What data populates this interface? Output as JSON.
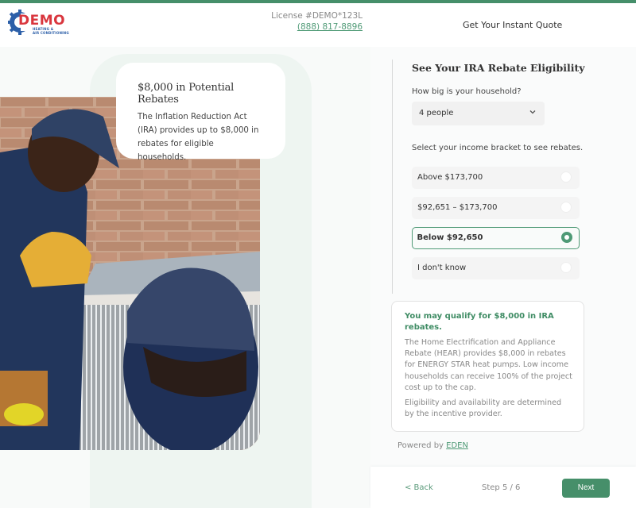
{
  "header": {
    "logo": {
      "brand": "DEMO",
      "subtitle_line1": "HEATING &",
      "subtitle_line2": "AIR CONDITIONING"
    },
    "license": "License #DEMO*123L",
    "phone": "(888) 817-8896",
    "quote_link": "Get Your Instant Quote"
  },
  "colors": {
    "accent": "#468f6a",
    "brand_red": "#d9363e",
    "brand_blue": "#2c5fa8"
  },
  "callout": {
    "title": "$8,000 in Potential Rebates",
    "body": "The Inflation Reduction Act (IRA) provides up to $8,000 in rebates for eligible households."
  },
  "photo": {
    "alt": "Two HVAC technicians servicing an outdoor air conditioning unit"
  },
  "form": {
    "title": "See Your IRA Rebate Eligibility",
    "household_label": "How big is your household?",
    "household_value": "4 people",
    "income_label": "Select your income bracket to see rebates.",
    "options": [
      {
        "label": "Above $173,700",
        "selected": false
      },
      {
        "label": "$92,651 – $173,700",
        "selected": false
      },
      {
        "label": "Below $92,650",
        "selected": true
      },
      {
        "label": "I don't know",
        "selected": false
      }
    ]
  },
  "info": {
    "headline": "You may qualify for $8,000 in IRA rebates.",
    "body": "The Home Electrification and Appliance Rebate (HEAR) provides $8,000 in rebates for ENERGY STAR heat pumps. Low income households can receive 100% of the project cost up to the cap.",
    "note": "Eligibility and availability are determined by the incentive provider."
  },
  "powered": {
    "prefix": "Powered by ",
    "link": "EDEN"
  },
  "footer": {
    "back": "< Back",
    "step": "Step 5 / 6",
    "next": "Next"
  }
}
